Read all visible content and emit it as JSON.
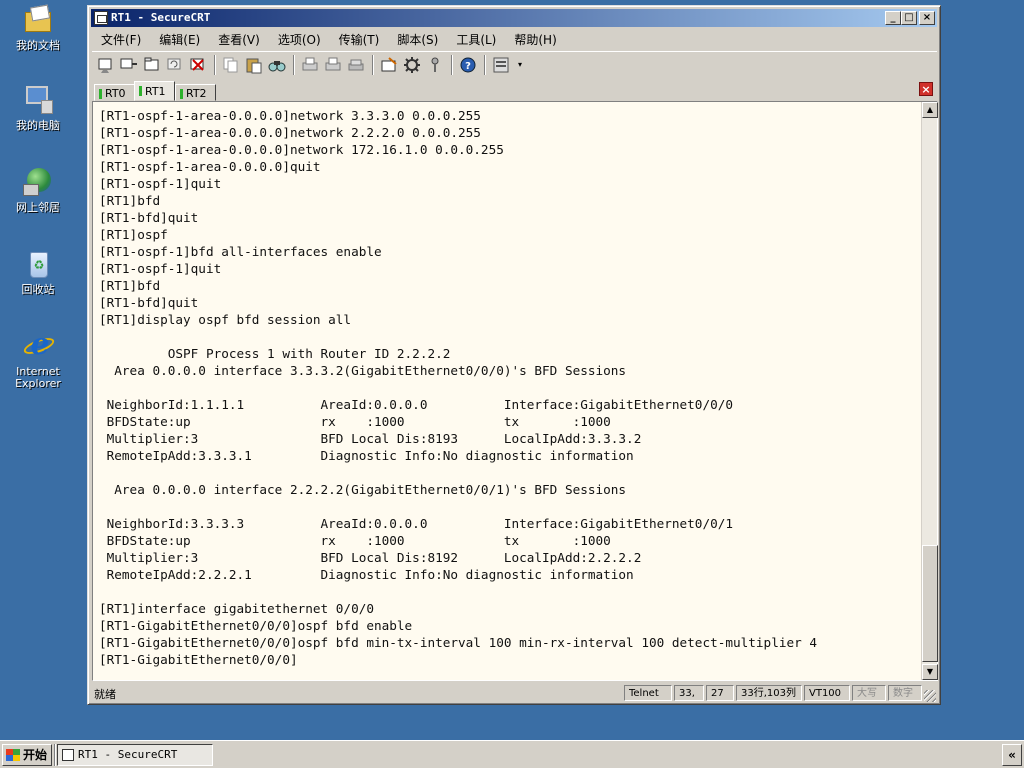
{
  "desktop": {
    "icons": [
      {
        "label": "我的文档",
        "icon": "my-documents-icon"
      },
      {
        "label": "我的电脑",
        "icon": "my-computer-icon"
      },
      {
        "label": "网上邻居",
        "icon": "network-places-icon"
      },
      {
        "label": "回收站",
        "icon": "recycle-bin-icon"
      },
      {
        "label_line1": "Internet",
        "label_line2": "Explorer",
        "icon": "internet-explorer-icon"
      }
    ]
  },
  "window": {
    "title": "RT1 - SecureCRT",
    "controls": {
      "minimize": "_",
      "maximize": "□",
      "close": "×"
    },
    "menu": [
      "文件(F)",
      "编辑(E)",
      "查看(V)",
      "选项(O)",
      "传输(T)",
      "脚本(S)",
      "工具(L)",
      "帮助(H)"
    ],
    "tabs": [
      {
        "label": "RT0",
        "active": false
      },
      {
        "label": "RT1",
        "active": true
      },
      {
        "label": "RT2",
        "active": false
      }
    ],
    "tab_close": "×",
    "terminal_lines": [
      "[RT1-ospf-1-area-0.0.0.0]network 3.3.3.0 0.0.0.255",
      "[RT1-ospf-1-area-0.0.0.0]network 2.2.2.0 0.0.0.255",
      "[RT1-ospf-1-area-0.0.0.0]network 172.16.1.0 0.0.0.255",
      "[RT1-ospf-1-area-0.0.0.0]quit",
      "[RT1-ospf-1]quit",
      "[RT1]bfd",
      "[RT1-bfd]quit",
      "[RT1]ospf",
      "[RT1-ospf-1]bfd all-interfaces enable",
      "[RT1-ospf-1]quit",
      "[RT1]bfd",
      "[RT1-bfd]quit",
      "[RT1]display ospf bfd session all",
      "",
      "         OSPF Process 1 with Router ID 2.2.2.2",
      "  Area 0.0.0.0 interface 3.3.3.2(GigabitEthernet0/0/0)'s BFD Sessions",
      "",
      " NeighborId:1.1.1.1          AreaId:0.0.0.0          Interface:GigabitEthernet0/0/0",
      " BFDState:up                 rx    :1000             tx       :1000",
      " Multiplier:3                BFD Local Dis:8193      LocalIpAdd:3.3.3.2",
      " RemoteIpAdd:3.3.3.1         Diagnostic Info:No diagnostic information",
      "",
      "  Area 0.0.0.0 interface 2.2.2.2(GigabitEthernet0/0/1)'s BFD Sessions",
      "",
      " NeighborId:3.3.3.3          AreaId:0.0.0.0          Interface:GigabitEthernet0/0/1",
      " BFDState:up                 rx    :1000             tx       :1000",
      " Multiplier:3                BFD Local Dis:8192      LocalIpAdd:2.2.2.2",
      " RemoteIpAdd:2.2.2.1         Diagnostic Info:No diagnostic information",
      "",
      "[RT1]interface gigabitethernet 0/0/0",
      "[RT1-GigabitEthernet0/0/0]ospf bfd enable",
      "[RT1-GigabitEthernet0/0/0]ospf bfd min-tx-interval 100 min-rx-interval 100 detect-multiplier 4",
      "[RT1-GigabitEthernet0/0/0]"
    ],
    "status": {
      "ready": "就绪",
      "protocol": "Telnet",
      "row": "33,",
      "col": "27",
      "size": "33行,103列",
      "term": "VT100",
      "caps": "大写",
      "num": "数字"
    },
    "scroll_position": 0.95
  },
  "taskbar": {
    "start": "开始",
    "task": "RT1 - SecureCRT",
    "tray_toggle": "«"
  }
}
